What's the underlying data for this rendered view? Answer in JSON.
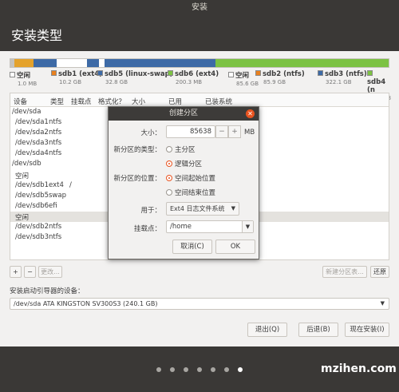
{
  "window": {
    "title": "安装"
  },
  "page": {
    "title": "安装类型"
  },
  "partitions_bar": {
    "segments": [
      {
        "color": "#c6c3bd",
        "share": 0.2
      },
      {
        "color": "#e4a22b",
        "share": 1.0
      },
      {
        "color": "#3d6aa6",
        "share": 1.2
      },
      {
        "color": "#ffffff",
        "share": 1.6
      },
      {
        "color": "#3d6aa6",
        "share": 0.6
      },
      {
        "color": "#ffffff",
        "share": 0.3
      },
      {
        "color": "#3d6aa6",
        "share": 5.8
      },
      {
        "color": "#7cc243",
        "share": 9.0
      }
    ]
  },
  "legend": [
    {
      "name": "空闲",
      "size": "1.0 MB",
      "color": "#ffffff"
    },
    {
      "name": "sdb1 (ext4)",
      "size": "10.2 GB",
      "color": "#e8801f"
    },
    {
      "name": "sdb5 (linux-swap)",
      "size": "32.8 GB",
      "color": "#3d6aa6"
    },
    {
      "name": "sdb6 (ext4)",
      "size": "200.3 MB",
      "color": "#7cc243"
    },
    {
      "name": "空闲",
      "size": "85.6 GB",
      "color": "#ffffff"
    },
    {
      "name": "sdb2 (ntfs)",
      "size": "85.9 GB",
      "color": "#e8801f"
    },
    {
      "name": "sdb3 (ntfs)",
      "size": "322.1 GB",
      "color": "#3d6aa6"
    },
    {
      "name": "sdb4 (n",
      "size": "463.3 G",
      "color": "#7cc243"
    }
  ],
  "table": {
    "headers": [
      "设备",
      "类型",
      "挂载点",
      "格式化？",
      "大小",
      "已用",
      "已装系统"
    ],
    "rows": [
      {
        "device": "/dev/sda",
        "type": "",
        "mount": ""
      },
      {
        "device": "/dev/sda1",
        "type": "ntfs",
        "mount": ""
      },
      {
        "device": "/dev/sda2",
        "type": "ntfs",
        "mount": ""
      },
      {
        "device": "/dev/sda3",
        "type": "ntfs",
        "mount": ""
      },
      {
        "device": "/dev/sda4",
        "type": "ntfs",
        "mount": ""
      },
      {
        "device": "/dev/sdb",
        "type": "",
        "mount": ""
      },
      {
        "device": "空闲",
        "type": "",
        "mount": ""
      },
      {
        "device": "/dev/sdb1",
        "type": "ext4",
        "mount": "/"
      },
      {
        "device": "/dev/sdb5",
        "type": "swap",
        "mount": ""
      },
      {
        "device": "/dev/sdb6",
        "type": "efi",
        "mount": ""
      },
      {
        "device": "空闲",
        "type": "",
        "mount": "",
        "selected": true
      },
      {
        "device": "/dev/sdb2",
        "type": "ntfs",
        "mount": ""
      },
      {
        "device": "/dev/sdb3",
        "type": "ntfs",
        "mount": ""
      }
    ]
  },
  "table_buttons": {
    "add": "+",
    "remove": "−",
    "change": "更改...",
    "new_table": "新建分区表...",
    "revert": "还原"
  },
  "boot": {
    "label": "安装启动引导器的设备：",
    "value": "/dev/sda    ATA KINGSTON SV300S3 (240.1 GB)"
  },
  "nav": {
    "quit": "退出(Q)",
    "back": "后退(B)",
    "install": "现在安装(I)"
  },
  "dialog": {
    "title": "创建分区",
    "size_label": "大小：",
    "size_value": "85638",
    "size_unit": "MB",
    "minus": "−",
    "plus": "+",
    "type_label": "新分区的类型：",
    "type_options": [
      {
        "label": "主分区",
        "selected": false
      },
      {
        "label": "逻辑分区",
        "selected": true
      }
    ],
    "location_label": "新分区的位置：",
    "location_options": [
      {
        "label": "空间起始位置",
        "selected": true
      },
      {
        "label": "空间结束位置",
        "selected": false
      }
    ],
    "use_label": "用于：",
    "use_value": "Ext4 日志文件系统",
    "mount_label": "挂载点：",
    "mount_value": "/home",
    "cancel": "取消(C)",
    "ok": "OK"
  },
  "progress": {
    "total_steps": 7,
    "current_step": 7
  },
  "watermark": "mzihen.com"
}
